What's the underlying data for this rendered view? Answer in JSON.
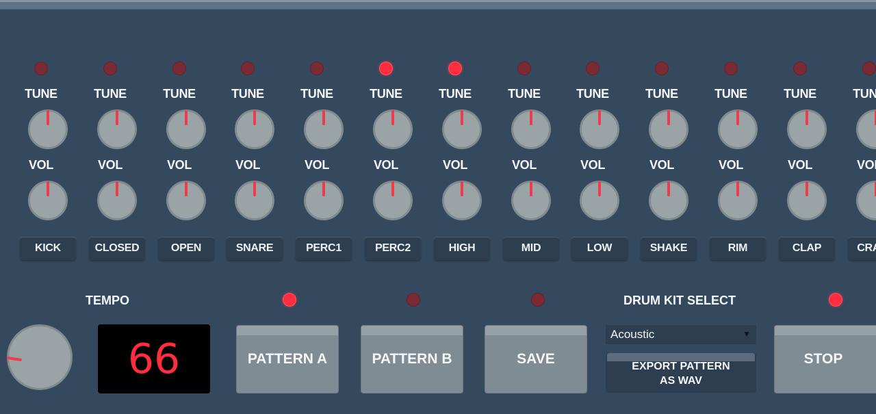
{
  "channels": [
    {
      "name": "KICK",
      "led_on": false,
      "tune_label": "TUNE",
      "vol_label": "VOL"
    },
    {
      "name": "CLOSED",
      "led_on": false,
      "tune_label": "TUNE",
      "vol_label": "VOL"
    },
    {
      "name": "OPEN",
      "led_on": false,
      "tune_label": "TUNE",
      "vol_label": "VOL"
    },
    {
      "name": "SNARE",
      "led_on": false,
      "tune_label": "TUNE",
      "vol_label": "VOL"
    },
    {
      "name": "PERC1",
      "led_on": false,
      "tune_label": "TUNE",
      "vol_label": "VOL"
    },
    {
      "name": "PERC2",
      "led_on": true,
      "tune_label": "TUNE",
      "vol_label": "VOL"
    },
    {
      "name": "HIGH",
      "led_on": true,
      "tune_label": "TUNE",
      "vol_label": "VOL"
    },
    {
      "name": "MID",
      "led_on": false,
      "tune_label": "TUNE",
      "vol_label": "VOL"
    },
    {
      "name": "LOW",
      "led_on": false,
      "tune_label": "TUNE",
      "vol_label": "VOL"
    },
    {
      "name": "SHAKE",
      "led_on": false,
      "tune_label": "TUNE",
      "vol_label": "VOL"
    },
    {
      "name": "RIM",
      "led_on": false,
      "tune_label": "TUNE",
      "vol_label": "VOL"
    },
    {
      "name": "CLAP",
      "led_on": false,
      "tune_label": "TUNE",
      "vol_label": "VOL"
    },
    {
      "name": "CRASH",
      "led_on": false,
      "tune_label": "TUNE",
      "vol_label": "VOL"
    }
  ],
  "knob_positions": {
    "tune": "center",
    "vol": "center"
  },
  "tempo": {
    "label": "TEMPO",
    "value": "66"
  },
  "buttons": {
    "pattern_a": {
      "label": "PATTERN A",
      "led_on": true
    },
    "pattern_b": {
      "label": "PATTERN B",
      "led_on": false
    },
    "save": {
      "label": "SAVE",
      "led_on": false
    },
    "stop": {
      "label": "STOP",
      "led_on": true
    }
  },
  "drum_kit": {
    "label": "DRUM KIT SELECT",
    "selected": "Acoustic",
    "arrow": "▼"
  },
  "export": {
    "line1": "EXPORT PATTERN",
    "line2": "AS WAV"
  },
  "colors": {
    "background": "#34495e",
    "led_on": "#ff2d3e",
    "led_off": "#7a2a32",
    "knob_indicator": "#ef3b4b",
    "display_text": "#ff2d3e"
  }
}
